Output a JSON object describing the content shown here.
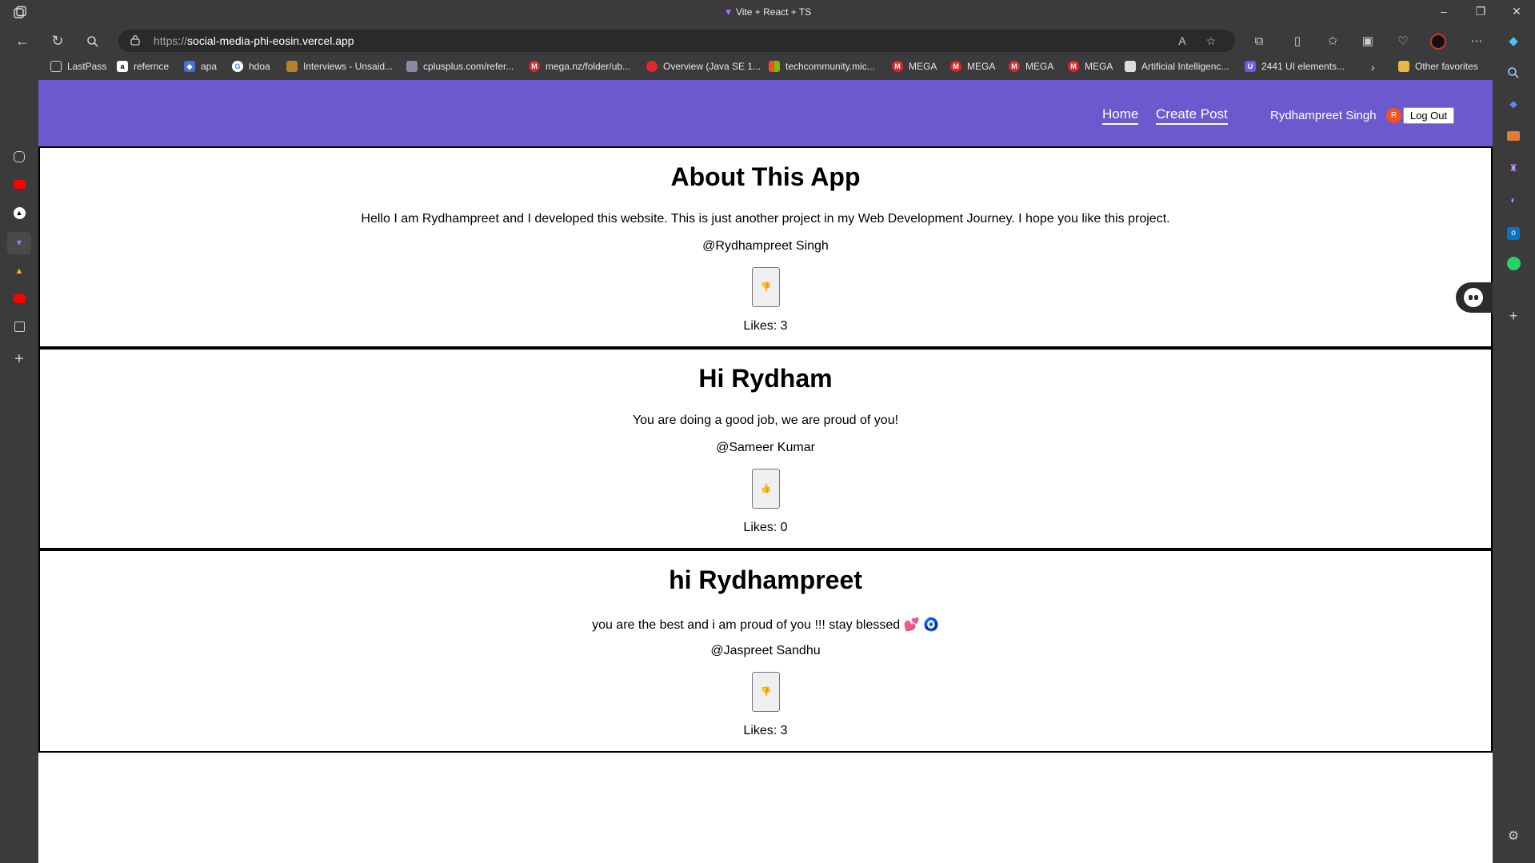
{
  "browser": {
    "window_title": "Vite + React + TS",
    "url_protocol": "https://",
    "url_host": "social-media-phi-eosin.vercel.app",
    "read_aloud_label": "A",
    "bookmarks": [
      {
        "label": "LastPass",
        "icon": "page-icon",
        "color": "#3b3b3b"
      },
      {
        "label": "refernce",
        "icon": "a-icon",
        "color": "#ffffff"
      },
      {
        "label": "apa",
        "icon": "apa-icon",
        "color": "#4a6fd8"
      },
      {
        "label": "hdoa",
        "icon": "google-icon",
        "color": "#ffffff"
      },
      {
        "label": "Interviews - Unsaid...",
        "icon": "interviews-icon",
        "color": "#b5812b"
      },
      {
        "label": "cplusplus.com/refer...",
        "icon": "cplusplus-icon",
        "color": "#8a8aa8"
      },
      {
        "label": "mega.nz/folder/ub...",
        "icon": "mega-icon",
        "color": "#d9272e"
      },
      {
        "label": "Overview (Java SE 1...",
        "icon": "oracle-icon",
        "color": "#e0262f"
      },
      {
        "label": "techcommunity.mic...",
        "icon": "microsoft-icon",
        "color": "#f25022"
      },
      {
        "label": "MEGA",
        "icon": "mega-icon",
        "color": "#d9272e"
      },
      {
        "label": "MEGA",
        "icon": "mega-icon",
        "color": "#d9272e"
      },
      {
        "label": "MEGA",
        "icon": "mega-icon",
        "color": "#d9272e"
      },
      {
        "label": "MEGA",
        "icon": "mega-icon",
        "color": "#d9272e"
      },
      {
        "label": "Artificial Intelligenc...",
        "icon": "ai-icon",
        "color": "#dddddd"
      },
      {
        "label": "2441 UI elements...",
        "icon": "ui-icon",
        "color": "#6c5ce7"
      }
    ],
    "other_favorites": "Other favorites"
  },
  "app": {
    "nav_home": "Home",
    "nav_create": "Create Post",
    "user_name": "Rydhampreet Singh",
    "avatar_initial": "R",
    "logout_label": "Log Out",
    "accent": "#6a5acd"
  },
  "posts": [
    {
      "title": "About This App",
      "body": "Hello I am Rydhampreet and I developed this website. This is just another project in my Web Development Journey. I hope you like this project.",
      "author": "@Rydhampreet Singh",
      "like_glyph": "👎",
      "likes": "Likes: 3"
    },
    {
      "title": "Hi Rydham",
      "body": "You are doing a good job, we are proud of you!",
      "author": "@Sameer Kumar",
      "like_glyph": "👍",
      "likes": "Likes: 0"
    },
    {
      "title": "hi Rydhampreet",
      "body": "you are the best and i am proud of you !!! stay blessed 💕 🧿",
      "author": "@Jaspreet Sandhu",
      "like_glyph": "👎",
      "likes": "Likes: 3"
    }
  ]
}
